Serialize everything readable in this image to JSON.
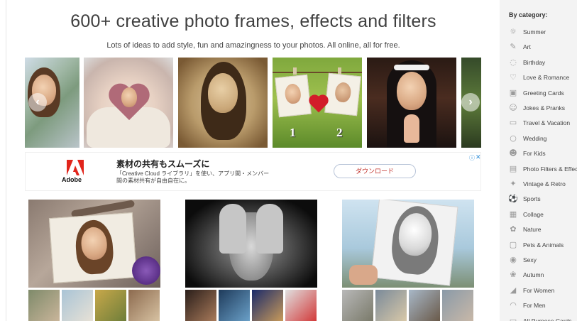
{
  "header": {
    "title": "600+ creative photo frames, effects and filters",
    "subtitle": "Lots of ideas to add style, fun and amazingness to your photos. All online, all for free."
  },
  "carousel": {
    "prev_icon": "chevron-left-icon",
    "next_icon": "chevron-right-icon",
    "slide4_numbers": [
      "1",
      "2"
    ]
  },
  "ad": {
    "brand_name": "Adobe",
    "headline": "素材の共有もスムーズに",
    "body_line1": "「Creative Cloud ライブラリ」を使い、アプリ間・メンバー",
    "body_line2": "間の素材共有が自由自在に。",
    "cta_label": "ダウンロード",
    "info_icon": "ⓘ",
    "close_icon": "✕",
    "brand_color": "#e1251b"
  },
  "sidebar": {
    "title": "By category:",
    "items": [
      {
        "label": "Summer",
        "icon": "sun-icon",
        "glyph": "☼"
      },
      {
        "label": "Art",
        "icon": "brush-icon",
        "glyph": "✎"
      },
      {
        "label": "Birthday",
        "icon": "balloon-icon",
        "glyph": "◌"
      },
      {
        "label": "Love & Romance",
        "icon": "heart-icon",
        "glyph": "♡"
      },
      {
        "label": "Greeting Cards",
        "icon": "card-icon",
        "glyph": "▣"
      },
      {
        "label": "Jokes & Pranks",
        "icon": "smile-icon",
        "glyph": "☺"
      },
      {
        "label": "Travel & Vacation",
        "icon": "suitcase-icon",
        "glyph": "▭"
      },
      {
        "label": "Wedding",
        "icon": "ring-icon",
        "glyph": "○"
      },
      {
        "label": "For Kids",
        "icon": "kids-icon",
        "glyph": "☻"
      },
      {
        "label": "Photo Filters & Effects",
        "icon": "filter-icon",
        "glyph": "▤"
      },
      {
        "label": "Vintage & Retro",
        "icon": "vintage-icon",
        "glyph": "✦"
      },
      {
        "label": "Sports",
        "icon": "ball-icon",
        "glyph": "⚽"
      },
      {
        "label": "Collage",
        "icon": "collage-icon",
        "glyph": "▦"
      },
      {
        "label": "Nature",
        "icon": "flower-icon",
        "glyph": "✿"
      },
      {
        "label": "Pets & Animals",
        "icon": "pet-icon",
        "glyph": "▢"
      },
      {
        "label": "Sexy",
        "icon": "lips-icon",
        "glyph": "◉"
      },
      {
        "label": "Autumn",
        "icon": "leaf-icon",
        "glyph": "❀"
      },
      {
        "label": "For Women",
        "icon": "shoe-icon",
        "glyph": "◢"
      },
      {
        "label": "For Men",
        "icon": "hat-icon",
        "glyph": "◠"
      },
      {
        "label": "All Purpose Cards",
        "icon": "cards-icon",
        "glyph": "▭"
      }
    ]
  }
}
